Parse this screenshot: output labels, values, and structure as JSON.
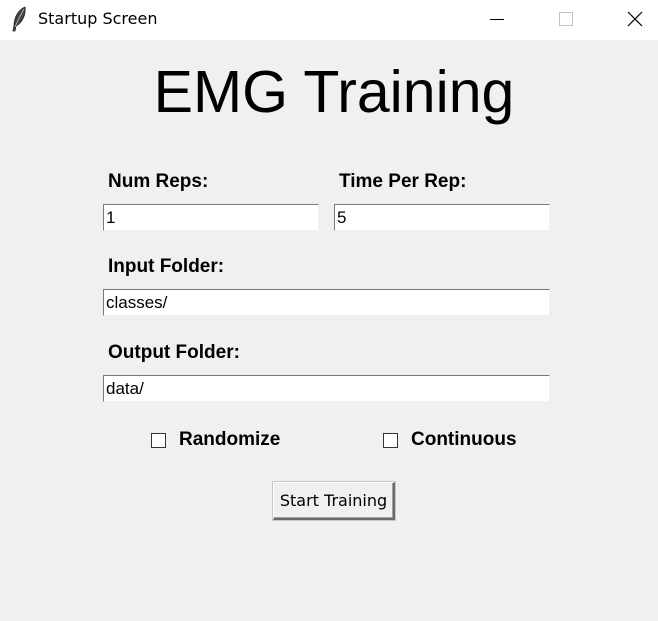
{
  "window": {
    "title": "Startup Screen",
    "icon": "feather-icon"
  },
  "main": {
    "heading": "EMG Training",
    "num_reps_label": "Num Reps:",
    "num_reps_value": "1",
    "time_per_rep_label": "Time Per Rep:",
    "time_per_rep_value": "5",
    "input_folder_label": "Input Folder:",
    "input_folder_value": "classes/",
    "output_folder_label": "Output Folder:",
    "output_folder_value": "data/",
    "randomize_label": "Randomize",
    "randomize_checked": false,
    "continuous_label": "Continuous",
    "continuous_checked": false,
    "start_button_label": "Start Training"
  }
}
